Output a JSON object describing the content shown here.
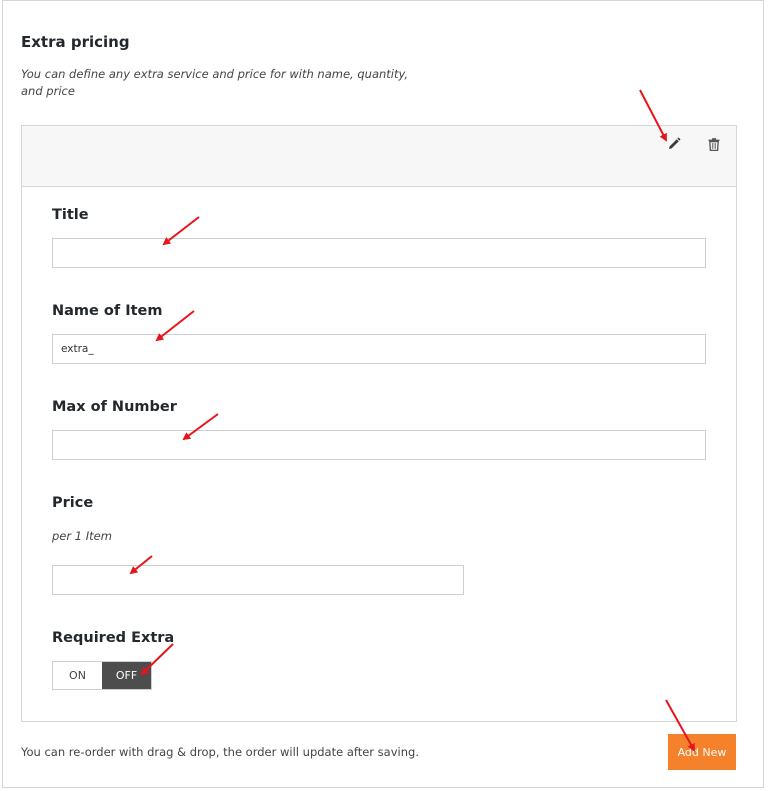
{
  "section": {
    "title": "Extra pricing",
    "description": "You can define any extra service and price for with name, quantity, and price"
  },
  "item_panel": {
    "actions": {
      "edit_icon": "pencil-icon",
      "delete_icon": "trash-icon"
    },
    "fields": {
      "title": {
        "label": "Title",
        "value": ""
      },
      "name_of_item": {
        "label": "Name of Item",
        "value": "extra_"
      },
      "max_of_number": {
        "label": "Max of Number",
        "value": ""
      },
      "price": {
        "label": "Price",
        "sublabel": "per 1 Item",
        "value": ""
      },
      "required_extra": {
        "label": "Required Extra",
        "on_label": "ON",
        "off_label": "OFF",
        "selected": "OFF"
      }
    }
  },
  "footer": {
    "note": "You can re-order with drag & drop, the order will update after saving.",
    "add_new_label": "Add New"
  },
  "colors": {
    "accent": "#f5822a",
    "toggle_active": "#4d4d4d",
    "annotation_arrow": "#e8141b"
  }
}
